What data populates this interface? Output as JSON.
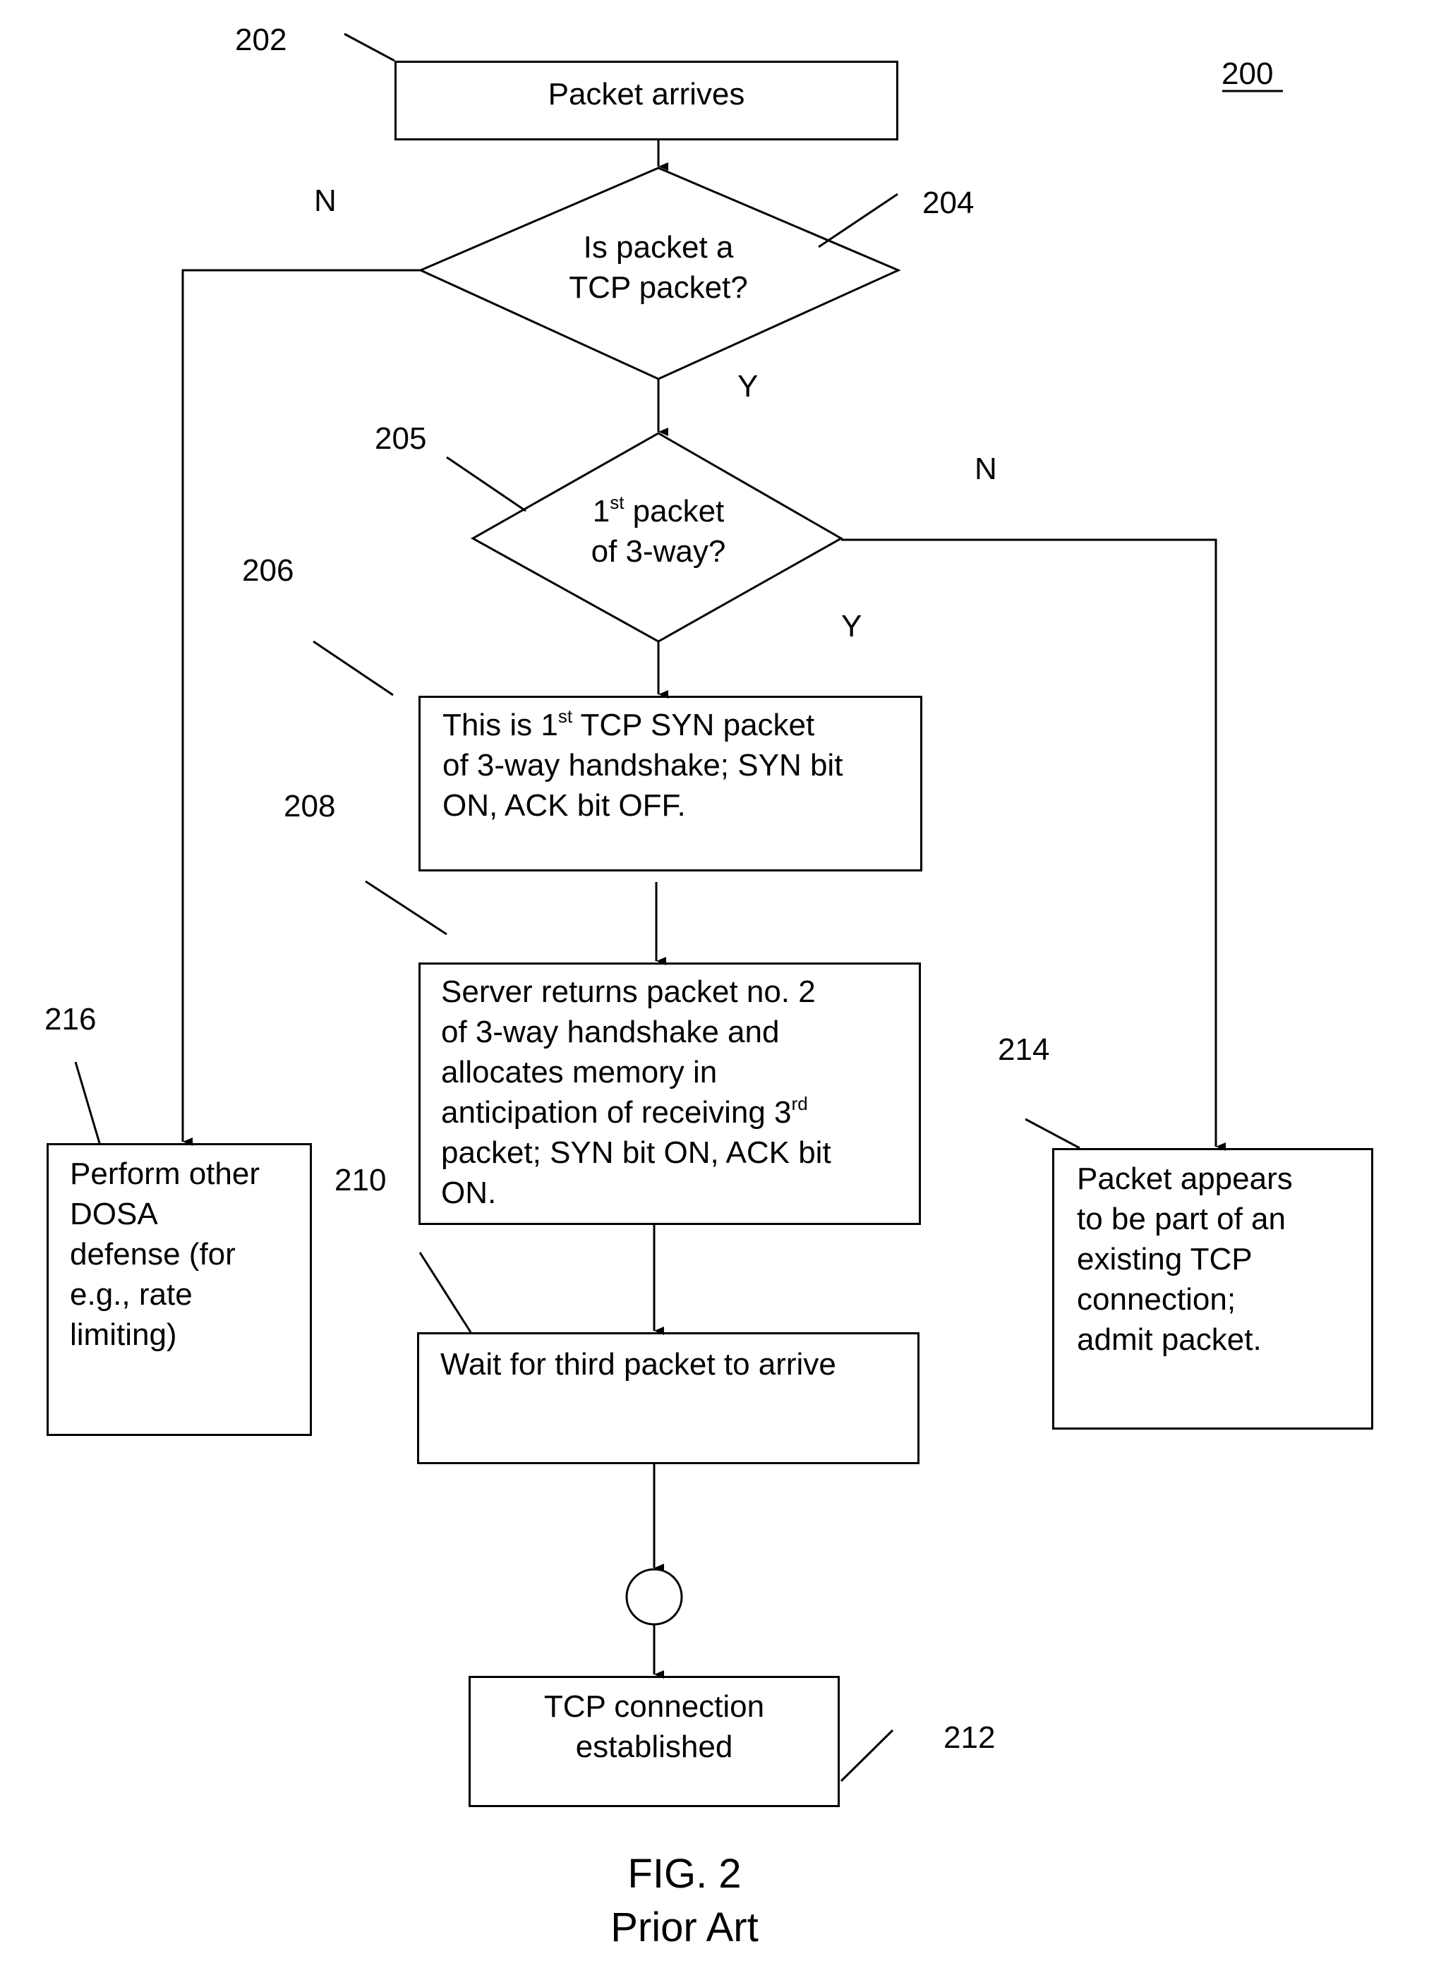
{
  "figure": {
    "number_label": "200",
    "caption": "FIG. 2",
    "subcaption": "Prior Art"
  },
  "nodes": {
    "n202": {
      "ref": "202",
      "text": "Packet arrives"
    },
    "n204": {
      "ref": "204",
      "line1": "Is packet a",
      "line2": "TCP packet?"
    },
    "n205": {
      "ref": "205",
      "line1_pre": "1",
      "line1_sup": "st",
      "line1_post": " packet",
      "line2": "of 3-way?"
    },
    "n206": {
      "ref": "206",
      "line1_pre": "This is 1",
      "line1_sup": "st",
      "line1_post": " TCP SYN packet",
      "line2": "of 3-way handshake; SYN bit",
      "line3": "ON, ACK bit OFF."
    },
    "n208": {
      "ref": "208",
      "line1": "Server returns packet no. 2",
      "line2": "of 3-way handshake and",
      "line3": "allocates memory in",
      "line4_pre": "anticipation of receiving 3",
      "line4_sup": "rd",
      "line5": "packet; SYN bit ON, ACK bit",
      "line6": "ON."
    },
    "n210": {
      "ref": "210",
      "text": "Wait for third packet to arrive"
    },
    "n212": {
      "ref": "212",
      "line1": "TCP connection",
      "line2": "established"
    },
    "n214": {
      "ref": "214",
      "lines": [
        "Packet appears",
        "to be part of an",
        "existing TCP",
        "connection;",
        "admit packet."
      ]
    },
    "n216": {
      "ref": "216",
      "lines": [
        "Perform other",
        "DOSA",
        "defense (for",
        "e.g., rate",
        "limiting)"
      ]
    }
  },
  "edge_labels": {
    "n204_no": "N",
    "n204_yes": "Y",
    "n205_no": "N",
    "n205_yes": "Y"
  }
}
